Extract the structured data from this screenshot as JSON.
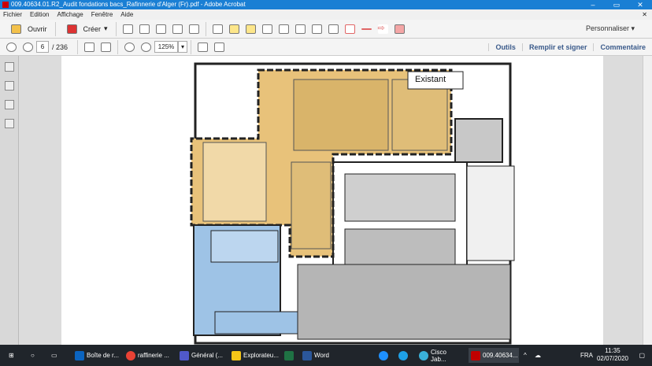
{
  "window": {
    "title": "009.40634.01.R2_Audit fondations bacs_Rafinnerie d'Alger (Fr).pdf - Adobe Acrobat"
  },
  "menu": [
    "Fichier",
    "Edition",
    "Affichage",
    "Fenêtre",
    "Aide"
  ],
  "toolbar": {
    "open": "Ouvrir",
    "create": "Créer",
    "customize": "Personnaliser"
  },
  "nav": {
    "page": "6",
    "total": "/ 236",
    "zoom": "125%"
  },
  "right": {
    "tools": "Outils",
    "fill_sign": "Remplir et signer",
    "comment": "Commentaire"
  },
  "document": {
    "label": "Existant"
  },
  "taskbar": {
    "items": [
      {
        "label": "Boîte de r...",
        "color": "#0b64c0"
      },
      {
        "label": "raffinerie ...",
        "color": "#e94235"
      },
      {
        "label": "Général (...",
        "color": "#5059c9"
      },
      {
        "label": "Explorateu...",
        "color": "#f5c518"
      },
      {
        "label": "",
        "color": "#1f7244"
      },
      {
        "label": "Word",
        "color": "#2b579a"
      },
      {
        "label": "",
        "color": "#1e90ff"
      },
      {
        "label": "",
        "color": "#1ea0e6"
      },
      {
        "label": "Cisco Jab...",
        "color": "#3ab0d8"
      },
      {
        "label": "009.40634...",
        "color": "#c00000"
      }
    ],
    "lang": "FRA",
    "time": "11:35",
    "date": "02/07/2020"
  }
}
